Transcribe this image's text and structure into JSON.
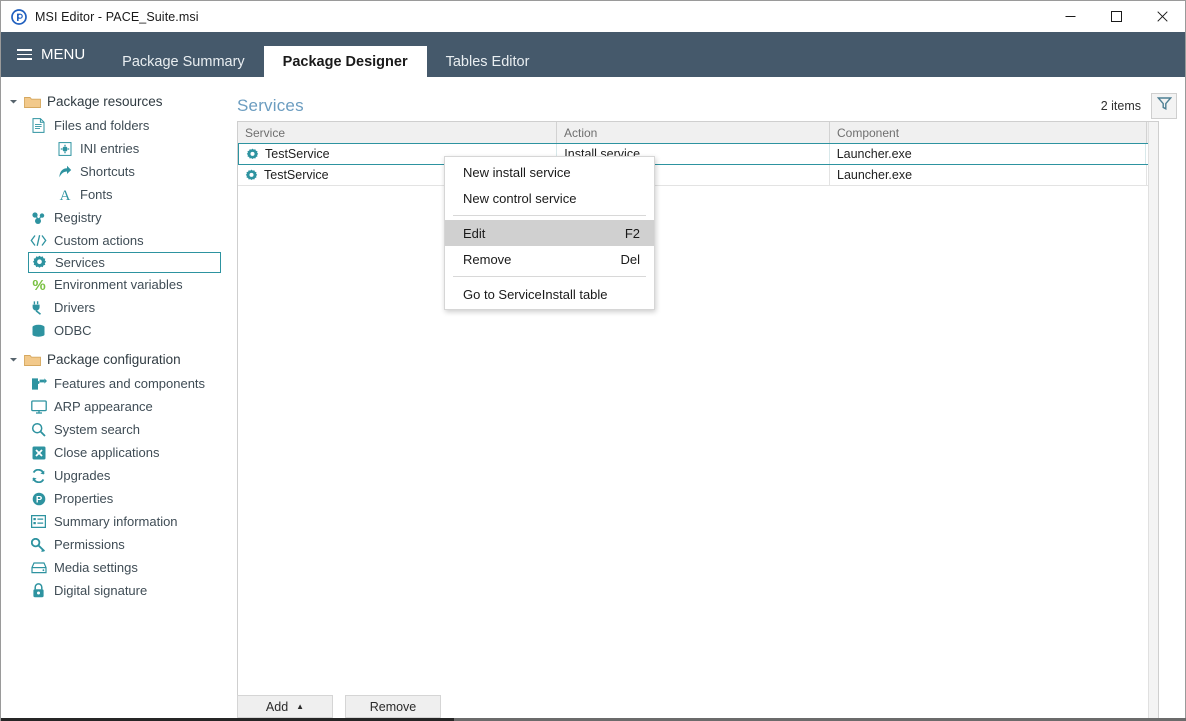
{
  "window": {
    "title": "MSI Editor - PACE_Suite.msi",
    "app_icon": "pace-logo-icon",
    "controls": [
      {
        "name": "minimize",
        "glyph": "minimize-icon"
      },
      {
        "name": "maximize",
        "glyph": "maximize-icon"
      },
      {
        "name": "close",
        "glyph": "close-icon"
      }
    ]
  },
  "ribbon": {
    "menu_label": "MENU",
    "tabs": [
      {
        "label": "Package Summary",
        "active": false
      },
      {
        "label": "Package Designer",
        "active": true
      },
      {
        "label": "Tables Editor",
        "active": false
      }
    ]
  },
  "sidebar": {
    "groups": [
      {
        "label": "Package resources",
        "icon": "folder-icon",
        "expanded": true,
        "items": [
          {
            "label": "Files and folders",
            "icon": "document-icon",
            "level": 1,
            "selected": false
          },
          {
            "label": "INI entries",
            "icon": "ini-file-icon",
            "level": 2,
            "selected": false
          },
          {
            "label": "Shortcuts",
            "icon": "shortcut-arrow-icon",
            "level": 2,
            "selected": false
          },
          {
            "label": "Fonts",
            "icon": "font-a-icon",
            "level": 2,
            "selected": false
          },
          {
            "label": "Registry",
            "icon": "registry-icon",
            "level": 1,
            "selected": false
          },
          {
            "label": "Custom actions",
            "icon": "code-brackets-icon",
            "level": 1,
            "selected": false
          },
          {
            "label": "Services",
            "icon": "gear-icon",
            "level": 1,
            "selected": true
          },
          {
            "label": "Environment variables",
            "icon": "percent-icon",
            "level": 1,
            "selected": false
          },
          {
            "label": "Drivers",
            "icon": "plug-icon",
            "level": 1,
            "selected": false
          },
          {
            "label": "ODBC",
            "icon": "database-icon",
            "level": 1,
            "selected": false
          }
        ]
      },
      {
        "label": "Package configuration",
        "icon": "folder-icon",
        "expanded": true,
        "items": [
          {
            "label": "Features and components",
            "icon": "puzzle-icon",
            "level": 1,
            "selected": false
          },
          {
            "label": "ARP appearance",
            "icon": "monitor-icon",
            "level": 1,
            "selected": false
          },
          {
            "label": "System search",
            "icon": "magnifier-icon",
            "level": 1,
            "selected": false
          },
          {
            "label": "Close applications",
            "icon": "x-square-icon",
            "level": 1,
            "selected": false
          },
          {
            "label": "Upgrades",
            "icon": "refresh-icon",
            "level": 1,
            "selected": false
          },
          {
            "label": "Properties",
            "icon": "p-circle-icon",
            "level": 1,
            "selected": false
          },
          {
            "label": "Summary information",
            "icon": "list-icon",
            "level": 1,
            "selected": false
          },
          {
            "label": "Permissions",
            "icon": "key-icon",
            "level": 1,
            "selected": false
          },
          {
            "label": "Media settings",
            "icon": "drive-icon",
            "level": 1,
            "selected": false
          },
          {
            "label": "Digital signature",
            "icon": "lock-icon",
            "level": 1,
            "selected": false
          }
        ]
      }
    ]
  },
  "main": {
    "title": "Services",
    "items_count": "2 items",
    "filter_icon": "filter-funnel-icon",
    "table": {
      "columns": [
        "Service",
        "Action",
        "Component",
        ""
      ],
      "rows": [
        {
          "service": "TestService",
          "action": "Install service",
          "component": "Launcher.exe",
          "extra": "",
          "icon": "gear-icon",
          "selected": true
        },
        {
          "service": "TestService",
          "action": "",
          "component": "Launcher.exe",
          "extra": "",
          "icon": "gear-icon",
          "selected": false
        }
      ]
    },
    "buttons": {
      "add_label": "Add",
      "add_caret": "▲",
      "remove_label": "Remove"
    }
  },
  "context_menu": {
    "items": [
      {
        "label": "New install service",
        "accel": "",
        "highlight": false,
        "separator_after": false
      },
      {
        "label": "New control service",
        "accel": "",
        "highlight": false,
        "separator_after": true
      },
      {
        "label": "Edit",
        "accel": "F2",
        "highlight": true,
        "separator_after": false
      },
      {
        "label": "Remove",
        "accel": "Del",
        "highlight": false,
        "separator_after": true
      },
      {
        "label": "Go to ServiceInstall table",
        "accel": "",
        "highlight": false,
        "separator_after": false
      }
    ]
  },
  "colors": {
    "ribbon": "#45596b",
    "accent_teal": "#2d93a0",
    "title_blue": "#6c9dc0",
    "icon_teal": "#2e93a0"
  }
}
